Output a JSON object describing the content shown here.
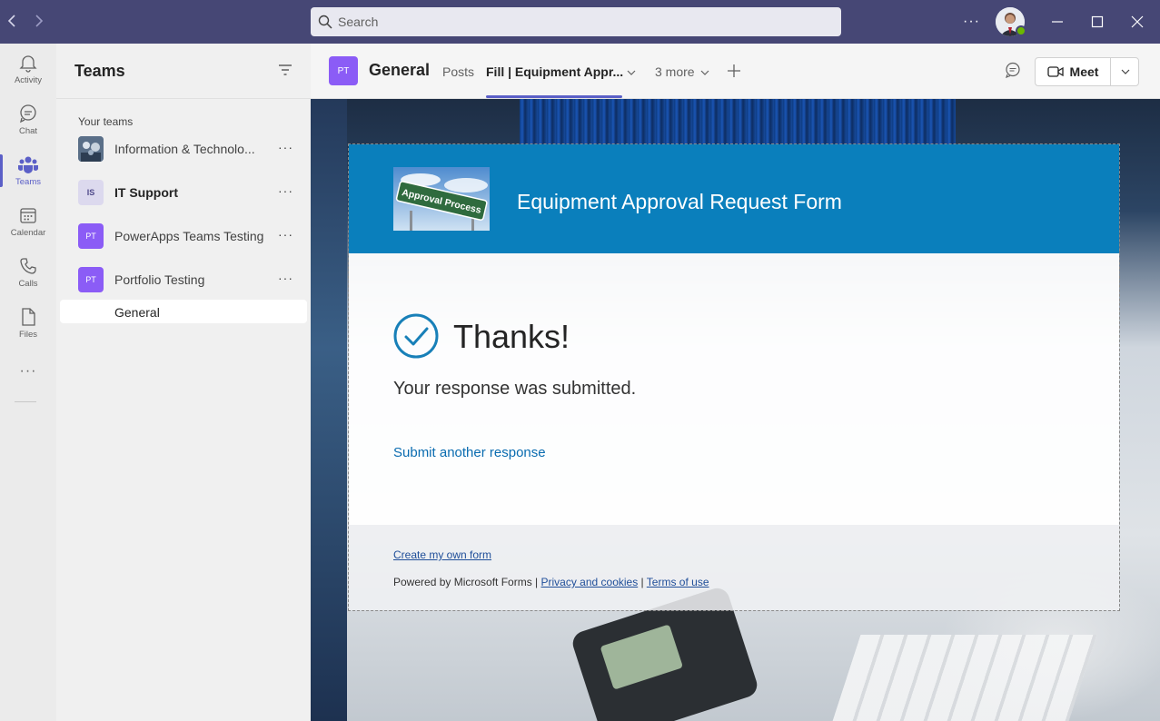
{
  "titlebar": {
    "search_placeholder": "Search",
    "more_label": "···"
  },
  "rail": {
    "items": [
      {
        "label": "Activity",
        "icon": "bell-icon"
      },
      {
        "label": "Chat",
        "icon": "chat-icon"
      },
      {
        "label": "Teams",
        "icon": "teams-icon"
      },
      {
        "label": "Calendar",
        "icon": "calendar-icon"
      },
      {
        "label": "Calls",
        "icon": "phone-icon"
      },
      {
        "label": "Files",
        "icon": "file-icon"
      }
    ],
    "more_label": "···"
  },
  "panel": {
    "title": "Teams",
    "section_label": "Your teams",
    "teams": [
      {
        "name": "Information & Technolo...",
        "avatar_text": "",
        "bold": false
      },
      {
        "name": "IT Support",
        "avatar_text": "IS",
        "bold": true
      },
      {
        "name": "PowerApps Teams Testing",
        "avatar_text": "PT",
        "bold": false
      },
      {
        "name": "Portfolio Testing",
        "avatar_text": "PT",
        "bold": false
      }
    ],
    "channel": "General",
    "dots": "···"
  },
  "channel_header": {
    "avatar_text": "PT",
    "title": "General",
    "tabs": {
      "posts": "Posts",
      "active": "Fill | Equipment Appr...",
      "more": "3 more"
    },
    "meet_label": "Meet"
  },
  "form": {
    "title": "Equipment Approval Request Form",
    "banner_sign_text": "Approval Process",
    "thanks": "Thanks!",
    "submitted": "Your response was submitted.",
    "another_link": "Submit another response",
    "footer": {
      "create_link": "Create my own form",
      "powered_by": "Powered by Microsoft Forms | ",
      "privacy": "Privacy and cookies",
      "separator": " | ",
      "terms": "Terms of use"
    }
  },
  "colors": {
    "titlebar": "#464775",
    "accent": "#5b5fc7",
    "form_banner": "#0a7fbc",
    "team_purple": "#8b5cf6"
  }
}
